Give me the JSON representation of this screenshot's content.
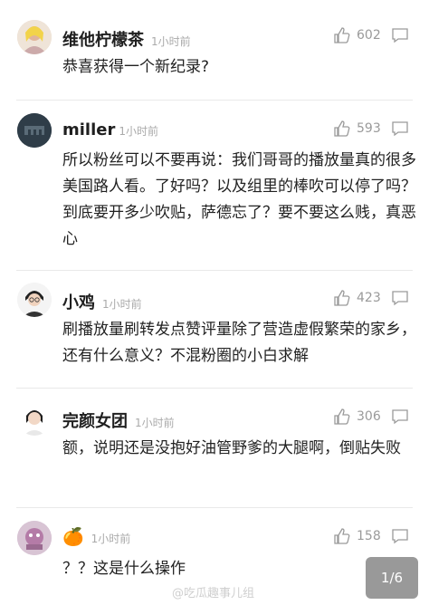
{
  "comments": [
    {
      "name": "维他柠檬茶",
      "time": "1小时前",
      "likes": "602",
      "text": "恭喜获得一个新纪录?"
    },
    {
      "name": "miller",
      "time": "1小时前",
      "likes": "593",
      "text": "所以粉丝可以不要再说：我们哥哥的播放量真的很多美国路人看。了好吗？以及组里的棒吹可以停了吗？到底要开多少吹贴，萨德忘了？要不要这么贱，真恶心"
    },
    {
      "name": "小鸡",
      "time": "1小时前",
      "likes": "423",
      "text": "刷播放量刷转发点赞评量除了营造虚假繁荣的家乡，还有什么意义？不混粉圈的小白求解"
    },
    {
      "name": "完颜女团",
      "time": "1小时前",
      "likes": "306",
      "text": "额，说明还是没抱好油管野爹的大腿啊，倒贴失败"
    },
    {
      "name": "🍊",
      "time": "1小时前",
      "likes": "158",
      "text": "？？这是什么操作"
    }
  ],
  "pager": "1/6",
  "watermark": "@吃瓜趣事儿组"
}
